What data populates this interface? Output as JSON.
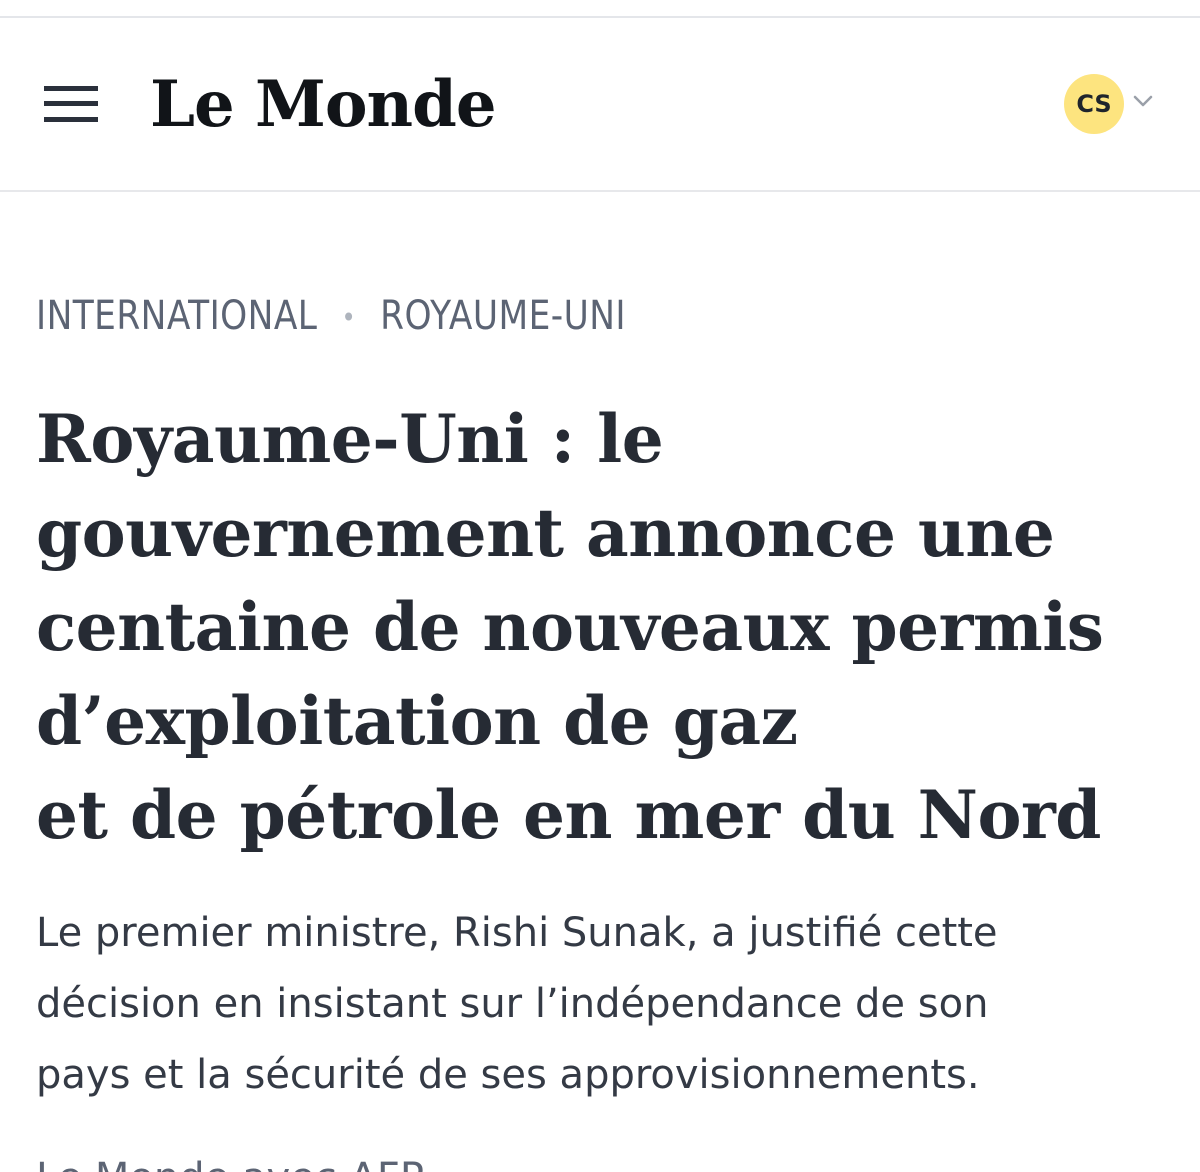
{
  "header": {
    "logo_text": "Le Monde",
    "account_initials": "CS",
    "menu_icon": "hamburger-menu-icon",
    "chevron_icon": "chevron-down-icon",
    "avatar_color": "#fde47f"
  },
  "breadcrumb": {
    "items": [
      {
        "label": "INTERNATIONAL"
      },
      {
        "label": "ROYAUME-UNI"
      }
    ],
    "separator": "•"
  },
  "article": {
    "headline_lines": [
      "Royaume-Uni : le",
      "gouvernement annonce une",
      "centaine de nouveaux permis",
      "d’exploitation de gaz",
      "et de pétrole en mer du Nord"
    ],
    "lead_lines": [
      "Le premier ministre, Rishi Sunak, a justifié cette",
      "décision en insistant sur l’indépendance de son",
      "pays et la sécurité de ses approvisionnements."
    ],
    "byline_partial": "Le Monde avec AFP"
  },
  "colors": {
    "headline": "#262b34",
    "lead": "#343a45",
    "breadcrumb": "#5c6474"
  }
}
